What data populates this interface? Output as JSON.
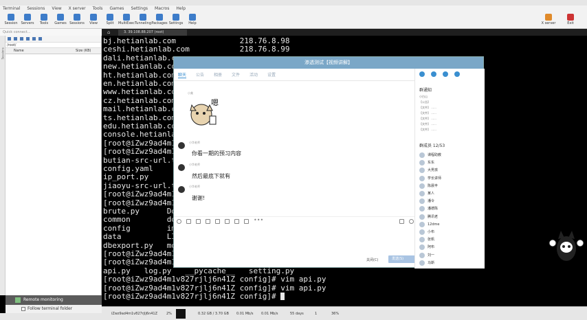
{
  "app": {
    "menus": [
      "Terminal",
      "Sessions",
      "View",
      "X server",
      "Tools",
      "Games",
      "Settings",
      "Macros",
      "Help"
    ],
    "toolbar": [
      {
        "label": "Session",
        "icon": "session-icon"
      },
      {
        "label": "Servers",
        "icon": "servers-icon"
      },
      {
        "label": "Tools",
        "icon": "tools-icon"
      },
      {
        "label": "Games",
        "icon": "games-icon"
      },
      {
        "label": "Sessions",
        "icon": "sessions-icon"
      },
      {
        "label": "View",
        "icon": "view-icon"
      },
      {
        "label": "Split",
        "icon": "split-icon"
      },
      {
        "label": "MultiExec",
        "icon": "multiexec-icon"
      },
      {
        "label": "Tunneling",
        "icon": "tunneling-icon"
      },
      {
        "label": "Packages",
        "icon": "packages-icon"
      },
      {
        "label": "Settings",
        "icon": "settings-icon"
      },
      {
        "label": "Help",
        "icon": "help-icon"
      }
    ],
    "toolbar_right": [
      {
        "label": "X server",
        "icon": "x-server-icon"
      },
      {
        "label": "Exit",
        "icon": "exit-icon"
      }
    ],
    "quick_connect": "Quick connect...",
    "tab": {
      "label": "3. 39.108.88.207 (root)"
    },
    "colors": {
      "accent": "#3a8fd0",
      "chat_title": "#7aa7c7",
      "terminal_bg": "#000000"
    }
  },
  "sftp": {
    "path": "/root/",
    "col_name": "Name",
    "col_size": "Size (KB)",
    "remote_monitoring": "Remote monitoring",
    "follow_folder": "Follow terminal folder"
  },
  "terminal": {
    "lines": [
      "bj.hetianlab.com              218.76.8.98",
      "ceshi.hetianlab.com           218.76.8.99",
      "dali.hetianlab.com",
      "new.hetianlab.com",
      "ht.hetianlab.com",
      "en.hetianlab.com",
      "www.hetianlab.com",
      "cz.hetianlab.com",
      "mail.hetianlab.com",
      "ts.hetianlab.com",
      "edu.hetianlab.com",
      "console.hetianla",
      "[root@iZwz9ad4m1",
      "[root@iZwz9ad4m1",
      "butian-src-url.t",
      "config.yaml",
      "ip_port.py",
      "jiaoyu-src-url.t",
      "[root@iZwz9ad4m1",
      "[root@iZwz9ad4m1",
      "brute.py      Doc",
      "common        doc",
      "config        ima",
      "data          LIC",
      "dbexport.py   mod",
      "[root@iZwz9ad4m1",
      "[root@iZwz9ad4m1",
      "api.py   log.py   __pycache__   setting.py",
      "[root@iZwz9ad4m1v827rjlj6n41Z config]# vim api.py",
      "[root@iZwz9ad4m1v827rjlj6n41Z config]# vim api.py",
      "[root@iZwz9ad4m1v827rjlj6n41Z config]# "
    ]
  },
  "status": {
    "host": "iZwz9ad4m1v827rjlj6n41Z",
    "cpu": "2%",
    "mem": "0.32 GB / 3.70 GB",
    "upload": "0.01 Mb/s",
    "download": "0.01 Mb/s",
    "uptime": "55 days",
    "users": "1",
    "disk": "36%"
  },
  "chat": {
    "title": "渗透测试【视频讲解】",
    "tabs": [
      "聊天",
      "公告",
      "相册",
      "文件",
      "活动",
      "设置"
    ],
    "messages": [
      {
        "name": "小美",
        "text": ""
      },
      {
        "name": "小华老师",
        "text": "你看一期的预习内容"
      },
      {
        "name": "小华老师",
        "text": "然后最底下就有"
      },
      {
        "name": "小华老师",
        "text": "谢谢!"
      }
    ],
    "sticker_text": "嗯",
    "notice_title": "群通知",
    "notice_lines": [
      "小白山",
      "【公告】",
      "【文件】 ......",
      "【文件】 ......",
      "【文件】 ......",
      "【文件】 ......",
      "【文件】 ......"
    ],
    "members_title": "群成员 12/53",
    "members": [
      "课程助教",
      "东东",
      "大男孩",
      "学长讲师",
      "陈晨丰",
      "某人",
      "潘令",
      "潘德陈",
      "腾讯老",
      "12dme",
      "小布",
      "张帆",
      "阿布",
      "刘一",
      "马斯"
    ],
    "close_button": "关闭(C)",
    "send_button": "发送(S)"
  }
}
